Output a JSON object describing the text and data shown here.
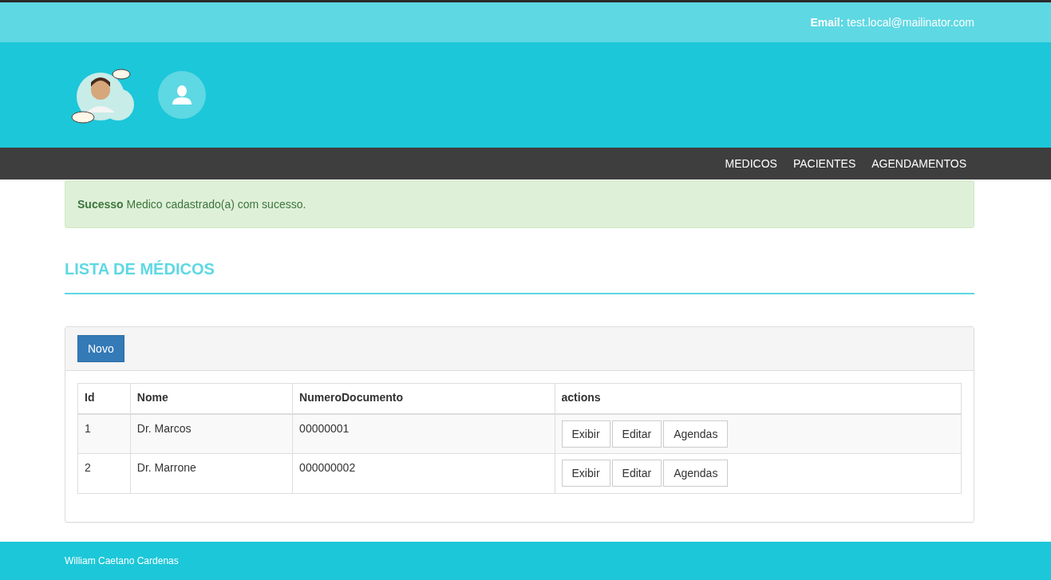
{
  "top_bar": {
    "email": "**Email:** test.local@mailinator.com"
  },
  "nav": {
    "items": [
      "MEDICOS",
      "PACIENTES",
      "AGENDAMENTOS"
    ]
  },
  "alert": {
    "text": "**Sucesso** Medico cadastrado(a) com sucesso."
  },
  "page_title": "LISTA DE MÉDICOS",
  "panel": {
    "new_button": "Novo",
    "table": {
      "columns": [
        "Id",
        "Nome",
        "NumeroDocumento",
        "actions"
      ],
      "rows": [
        {
          "cells": [
            "1",
            "Dr. Marcos",
            "00000001"
          ],
          "actions": [
            "Exibir",
            "Editar",
            "Agendas"
          ]
        },
        {
          "cells": [
            "2",
            "Dr. Marrone",
            "000000002"
          ],
          "actions": [
            "Exibir",
            "Editar",
            "Agendas"
          ]
        }
      ]
    }
  },
  "footer": {
    "text": "William Caetano Cardenas"
  }
}
